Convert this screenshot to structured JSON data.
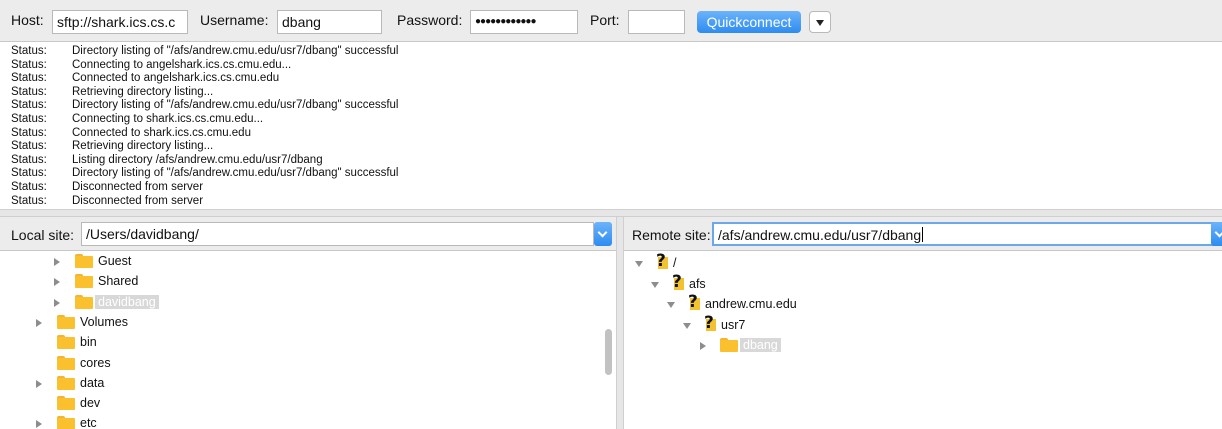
{
  "quickconnect": {
    "host_label": "Host:",
    "host_value": "sftp://shark.ics.cs.c",
    "username_label": "Username:",
    "username_value": "dbang",
    "password_label": "Password:",
    "password_value": "●●●●●●●●●●●●",
    "port_label": "Port:",
    "port_value": "",
    "connect_label": "Quickconnect",
    "dropdown_icon": "triangle-down-icon"
  },
  "log": [
    {
      "status": "Status:",
      "message": "Directory listing of \"/afs/andrew.cmu.edu/usr7/dbang\" successful"
    },
    {
      "status": "Status:",
      "message": "Connecting to angelshark.ics.cs.cmu.edu..."
    },
    {
      "status": "Status:",
      "message": "Connected to angelshark.ics.cs.cmu.edu"
    },
    {
      "status": "Status:",
      "message": "Retrieving directory listing..."
    },
    {
      "status": "Status:",
      "message": "Directory listing of \"/afs/andrew.cmu.edu/usr7/dbang\" successful"
    },
    {
      "status": "Status:",
      "message": "Connecting to shark.ics.cs.cmu.edu..."
    },
    {
      "status": "Status:",
      "message": "Connected to shark.ics.cs.cmu.edu"
    },
    {
      "status": "Status:",
      "message": "Retrieving directory listing..."
    },
    {
      "status": "Status:",
      "message": "Listing directory /afs/andrew.cmu.edu/usr7/dbang"
    },
    {
      "status": "Status:",
      "message": "Directory listing of \"/afs/andrew.cmu.edu/usr7/dbang\" successful"
    },
    {
      "status": "Status:",
      "message": "Disconnected from server"
    },
    {
      "status": "Status:",
      "message": "Disconnected from server"
    }
  ],
  "local": {
    "label": "Local site:",
    "path": "/Users/davidbang/",
    "tree": [
      {
        "name": "Guest",
        "expander": "collapsed",
        "selected": false
      },
      {
        "name": "Shared",
        "expander": "collapsed",
        "selected": false
      },
      {
        "name": "davidbang",
        "expander": "collapsed",
        "selected": true
      },
      {
        "name": "Volumes",
        "expander": "collapsed",
        "selected": false
      },
      {
        "name": "bin",
        "expander": "none",
        "selected": false
      },
      {
        "name": "cores",
        "expander": "none",
        "selected": false
      },
      {
        "name": "data",
        "expander": "collapsed",
        "selected": false
      },
      {
        "name": "dev",
        "expander": "none",
        "selected": false
      },
      {
        "name": "etc",
        "expander": "collapsed",
        "selected": false
      }
    ]
  },
  "remote": {
    "label": "Remote site:",
    "path": "/afs/andrew.cmu.edu/usr7/dbang",
    "tree": [
      {
        "name": "/",
        "icon": "question-folder-icon",
        "expander": "expanded",
        "selected": false
      },
      {
        "name": "afs",
        "icon": "question-folder-icon",
        "expander": "expanded",
        "selected": false
      },
      {
        "name": "andrew.cmu.edu",
        "icon": "question-folder-icon",
        "expander": "expanded",
        "selected": false
      },
      {
        "name": "usr7",
        "icon": "question-folder-icon",
        "expander": "expanded",
        "selected": false
      },
      {
        "name": "dbang",
        "icon": "folder-icon",
        "expander": "collapsed",
        "selected": true
      }
    ]
  }
}
